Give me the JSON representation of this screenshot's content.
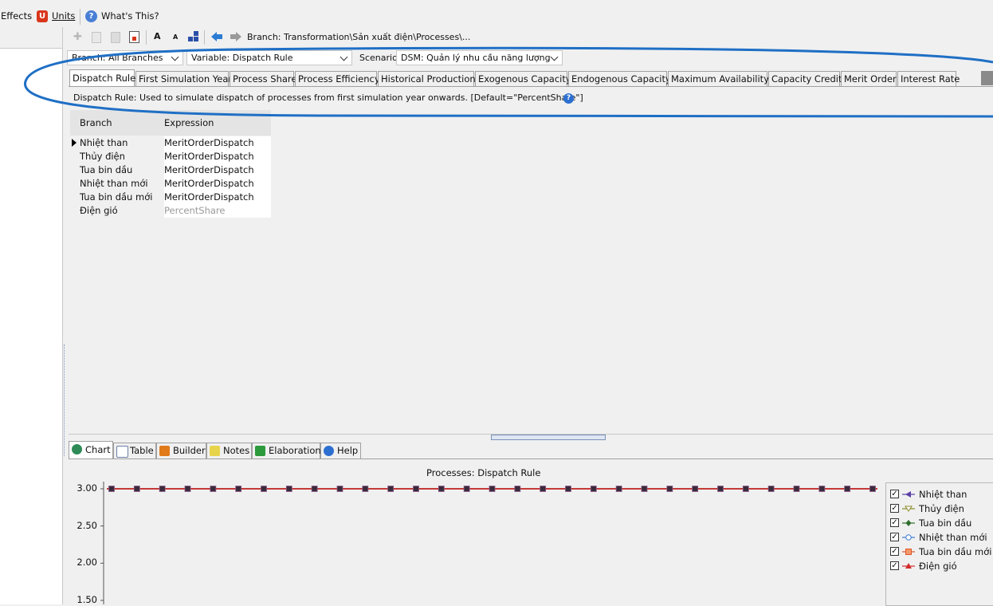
{
  "menu": {
    "effects": "Effects",
    "units": "Units",
    "whats_this": "What's This?"
  },
  "toolbar": {
    "font_up": "A",
    "font_down": "A",
    "branch_path": "Branch: Transformation\\Sản xuất điện\\Processes\\..."
  },
  "selectors": {
    "branch": "Branch: All Branches",
    "variable": "Variable: Dispatch Rule",
    "scenario_label": "Scenario:",
    "scenario": "DSM: Quản lý nhu cầu năng lượng"
  },
  "tabs": [
    "Dispatch Rule",
    "First Simulation Year",
    "Process Share",
    "Process Efficiency",
    "Historical Production",
    "Exogenous Capacity",
    "Endogenous Capacity",
    "Maximum Availability",
    "Capacity Credit",
    "Merit Order",
    "Interest Rate"
  ],
  "description": "Dispatch Rule: Used to simulate dispatch of processes from first simulation year onwards. [Default=\"PercentShare\"]",
  "grid": {
    "headers": [
      "Branch",
      "Expression"
    ],
    "rows": [
      {
        "branch": "Nhiệt than",
        "expression": "MeritOrderDispatch"
      },
      {
        "branch": "Thủy điện",
        "expression": "MeritOrderDispatch"
      },
      {
        "branch": "Tua bin dầu",
        "expression": "MeritOrderDispatch"
      },
      {
        "branch": "Nhiệt than mới",
        "expression": "MeritOrderDispatch"
      },
      {
        "branch": "Tua bin dầu mới",
        "expression": "MeritOrderDispatch"
      },
      {
        "branch": "Điện gió",
        "expression": "PercentShare"
      }
    ]
  },
  "bottom_tabs": [
    "Chart",
    "Table",
    "Builder",
    "Notes",
    "Elaboration",
    "Help"
  ],
  "chart_data": {
    "type": "line",
    "title": "Processes: Dispatch Rule",
    "yticks": [
      "3.00",
      "2.50",
      "2.00",
      "1.50"
    ],
    "ylim": [
      1.5,
      3.0
    ],
    "points_per_series": 31,
    "series": [
      {
        "name": "Nhiệt than",
        "value": 3.0,
        "color": "#5b3fa6",
        "marker": "arrow-left"
      },
      {
        "name": "Thủy điện",
        "value": 3.0,
        "color": "#8a8a2a",
        "marker": "triangle-down"
      },
      {
        "name": "Tua bin dầu",
        "value": 3.0,
        "color": "#2e6e2e",
        "marker": "diamond"
      },
      {
        "name": "Nhiệt than mới",
        "value": 3.0,
        "color": "#3b7bd6",
        "marker": "circle"
      },
      {
        "name": "Tua bin dầu mới",
        "value": 3.0,
        "color": "#e0572a",
        "marker": "square"
      },
      {
        "name": "Điện gió",
        "value": 3.0,
        "color": "#d42a2a",
        "marker": "triangle-up"
      }
    ],
    "legend_position": "right",
    "grid": false
  },
  "colors": {
    "annotation_ellipse": "#1f6fc5",
    "accent_icon_red": "#d9361c",
    "help_blue": "#2d6fd1"
  }
}
